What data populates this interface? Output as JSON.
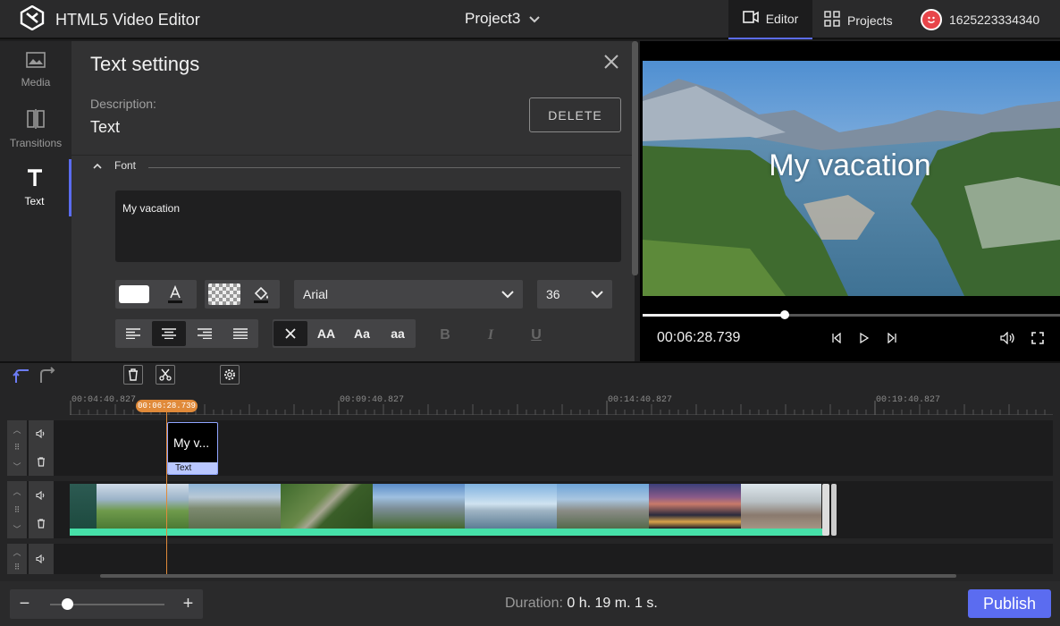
{
  "header": {
    "app_title": "HTML5 Video Editor",
    "project_name": "Project3",
    "nav_editor": "Editor",
    "nav_projects": "Projects",
    "user_id": "1625223334340"
  },
  "sidebar": {
    "items": [
      {
        "label": "Media",
        "icon": "image-icon"
      },
      {
        "label": "Transitions",
        "icon": "transitions-icon"
      },
      {
        "label": "Text",
        "icon": "text-icon"
      }
    ]
  },
  "panel": {
    "title": "Text settings",
    "description_label": "Description:",
    "description_value": "Text",
    "delete_label": "DELETE",
    "font_section": "Font",
    "text_value": "My vacation",
    "font_family": "Arial",
    "font_size": "36",
    "case_options": [
      "AA",
      "Aa",
      "aa"
    ],
    "style_options": [
      "B",
      "I",
      "U"
    ]
  },
  "preview": {
    "overlay_text": "My vacation",
    "timecode": "00:06:28.739",
    "progress": 0.34
  },
  "timeline": {
    "ruler_labels": [
      "00:04:40.827",
      "00:09:40.827",
      "00:14:40.827",
      "00:19:40.827"
    ],
    "playhead_time": "00:06:28.739",
    "text_clip_label": "My v...",
    "text_clip_tag": "Text"
  },
  "footer": {
    "zoom_level": 0.15,
    "duration_label": "Duration:",
    "duration_value": "0 h. 19 m. 1 s.",
    "publish_label": "Publish"
  },
  "colors": {
    "accent": "#5b6cf0",
    "playhead": "#e08a3a",
    "clip_bar": "#46e0a8"
  }
}
